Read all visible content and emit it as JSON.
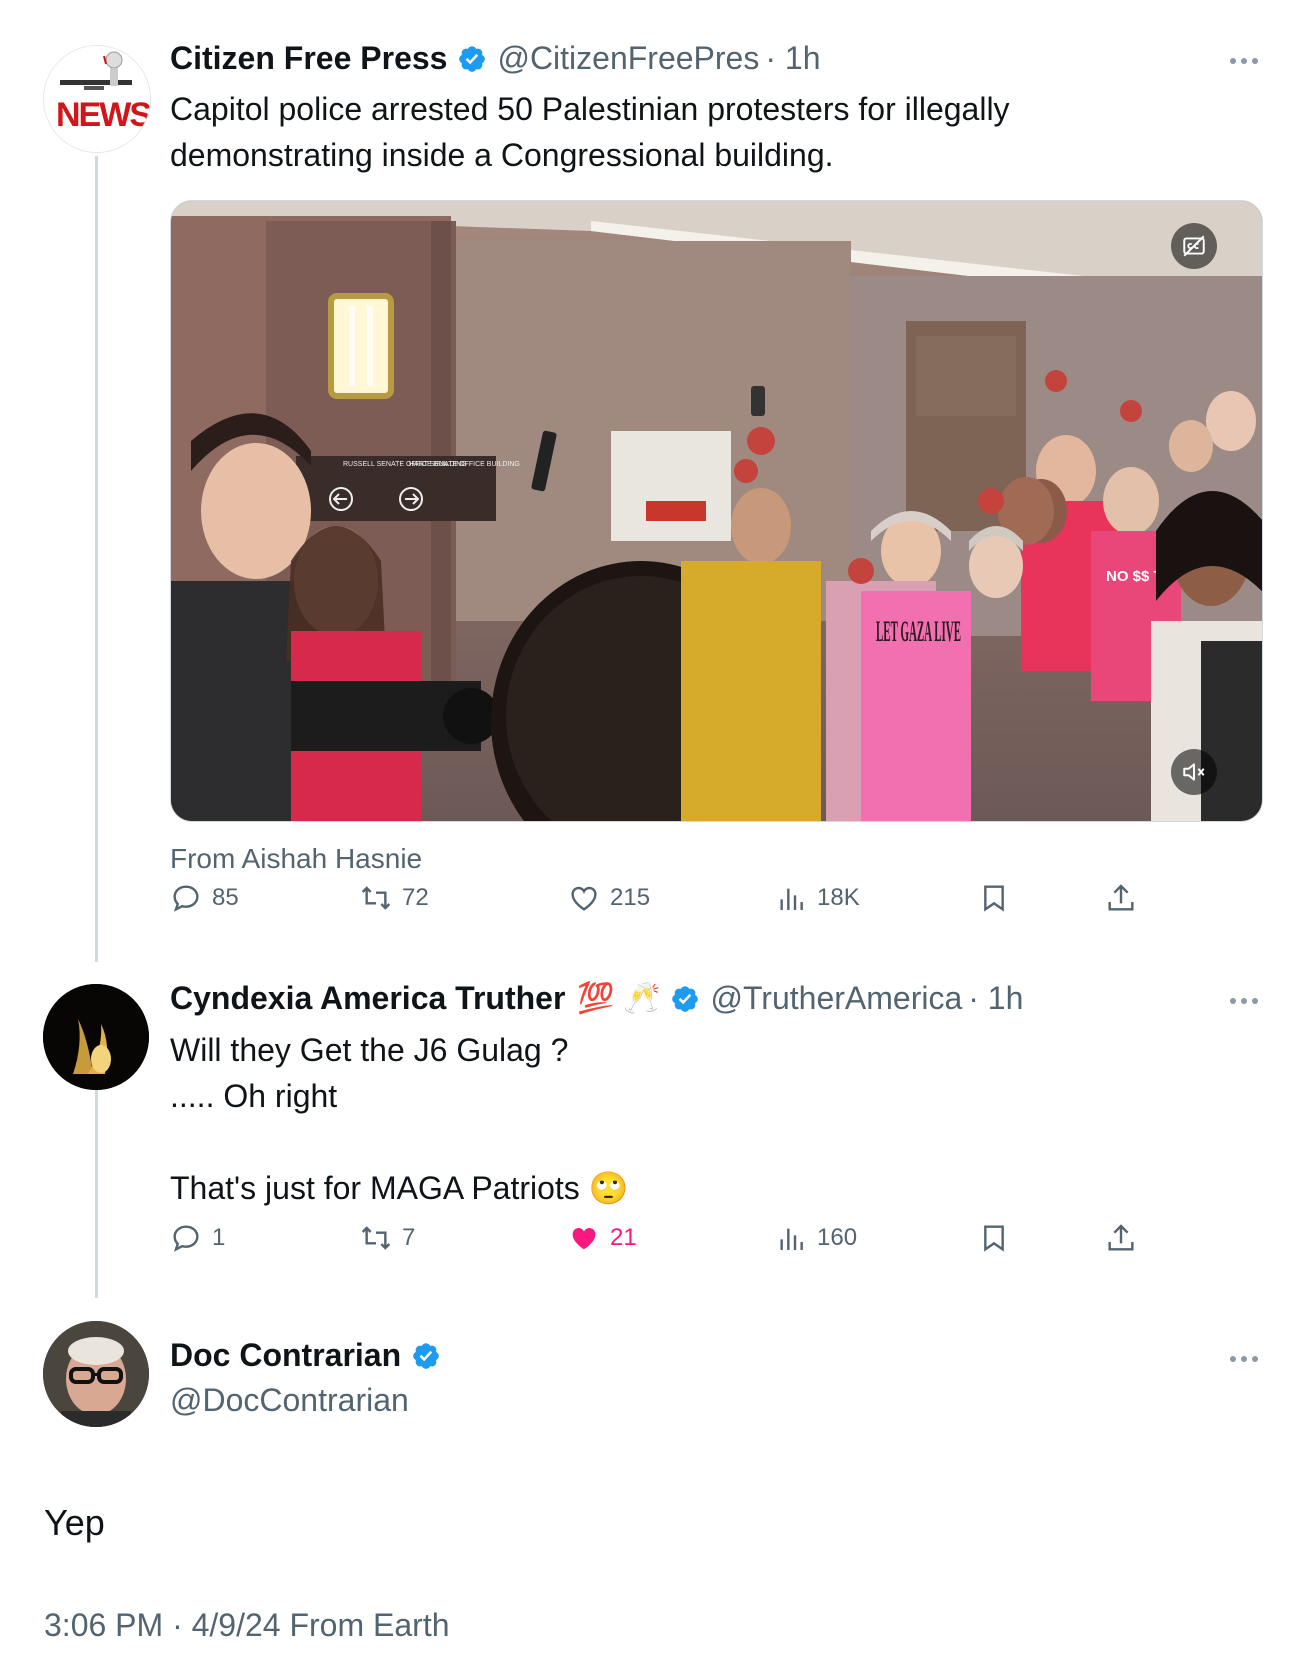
{
  "thread": [
    {
      "name": "Citizen Free Press",
      "handle": "@CitizenFreePres",
      "time": "· 1h",
      "text": "Capitol police arrested 50 Palestinian protesters for illegally\ndemonstrating inside a Congressional building.",
      "media_source": "From Aishah Hasnie",
      "media_signs": [
        "RUSSELL SENATE OFFICE BUILDING",
        "HART SENATE OFFICE BUILDING"
      ],
      "shirt_text": "LET GAZA LIVE",
      "sign_text": "NO $$ TO ISRAEL",
      "replies": "85",
      "reposts": "72",
      "likes": "215",
      "views": "18K",
      "liked": false
    },
    {
      "name": "Cyndexia America Truther",
      "name_emoji": "💯 🥂",
      "handle": "@TrutherAmerica",
      "time": "· 1h",
      "text": "Will they Get the J6 Gulag ?\n..... Oh right\n\nThat's just for MAGA Patriots 🙄",
      "replies": "1",
      "reposts": "7",
      "likes": "21",
      "views": "160",
      "liked": true
    }
  ],
  "main": {
    "name": "Doc Contrarian",
    "handle": "@DocContrarian",
    "text": "Yep",
    "timestamp": "3:06 PM · 4/9/24 From Earth"
  },
  "colors": {
    "text": "#0f1419",
    "secondary": "#536471",
    "verified": "#1d9bf0",
    "like": "#f91880",
    "thread_line": "#cfd9de"
  },
  "icons": [
    "reply-icon",
    "repost-icon",
    "like-icon",
    "views-icon",
    "bookmark-icon",
    "share-icon",
    "verified-icon",
    "more-icon",
    "captions-icon",
    "mute-icon"
  ]
}
